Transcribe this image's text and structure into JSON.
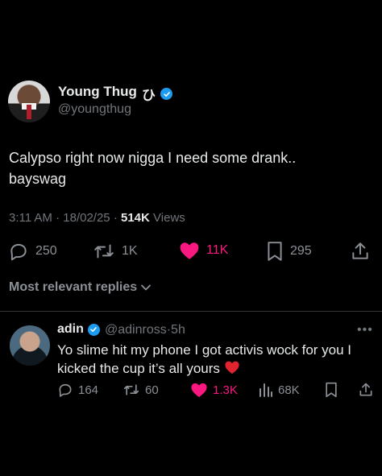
{
  "main_tweet": {
    "author_name": "Young Thug",
    "author_suffix": "ひ",
    "handle": "@youngthug",
    "text": "Calypso right now nigga I need some drank..\nbayswag",
    "time": "3:11 AM",
    "date": "18/02/25",
    "views_count": "514K",
    "views_label": "Views",
    "replies": "250",
    "reposts": "1K",
    "likes": "11K",
    "bookmarks": "295"
  },
  "replies_header": "Most relevant replies",
  "reply": {
    "author_name": "adin",
    "handle": "@adinross",
    "age": "5h",
    "text": "Yo slime hit my phone I got activis wock for you I kicked the cup it’s all yours",
    "replies": "164",
    "reposts": "60",
    "likes": "1.3K",
    "views": "68K"
  },
  "colors": {
    "background": "#000000",
    "text": "#e7e9ea",
    "muted": "#71767b",
    "like_pink": "#f91880",
    "verified_blue": "#1d9bf0"
  }
}
